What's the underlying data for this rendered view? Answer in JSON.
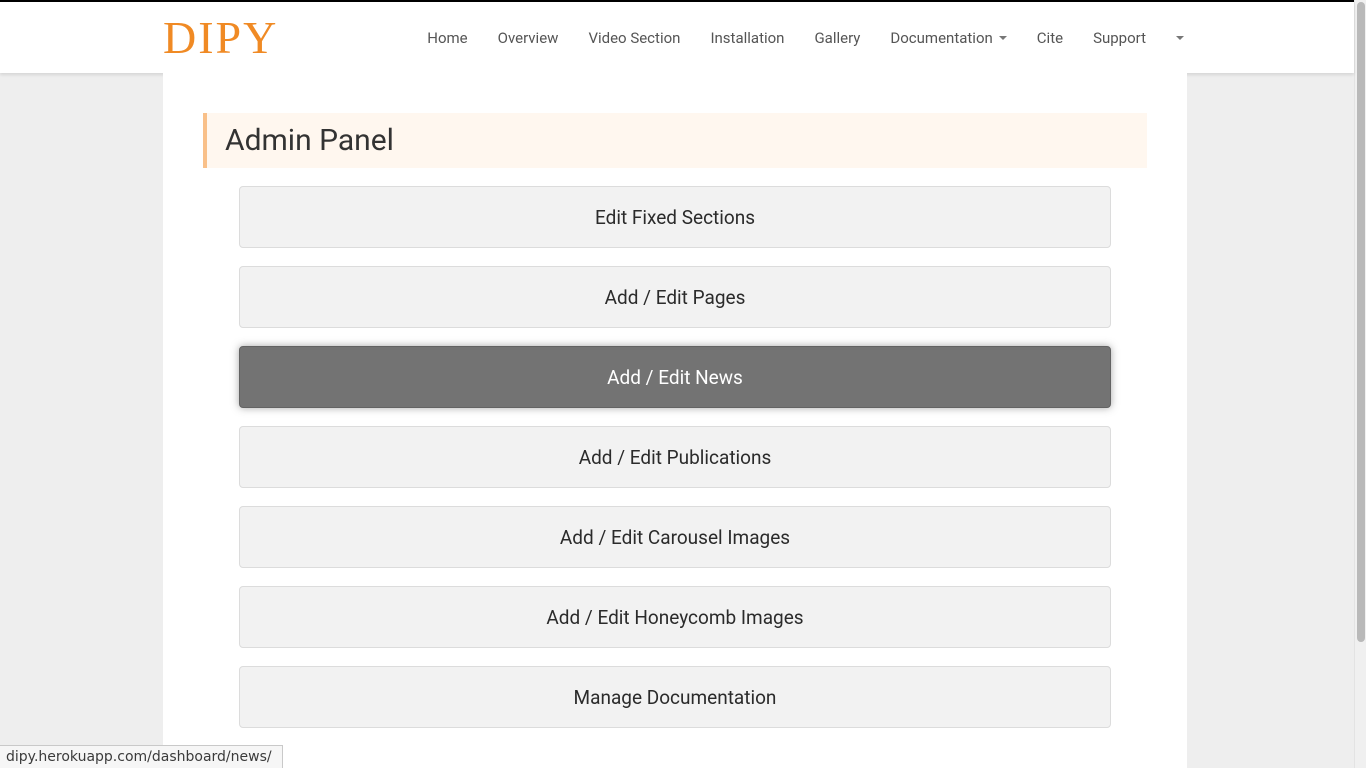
{
  "brand": "DIPY",
  "nav": {
    "home": "Home",
    "overview": "Overview",
    "video": "Video Section",
    "installation": "Installation",
    "gallery": "Gallery",
    "documentation": "Documentation",
    "cite": "Cite",
    "support": "Support"
  },
  "panel": {
    "title": "Admin Panel"
  },
  "buttons": {
    "fixed_sections": "Edit Fixed Sections",
    "pages": "Add / Edit Pages",
    "news": "Add / Edit News",
    "publications": "Add / Edit Publications",
    "carousel": "Add / Edit Carousel Images",
    "honeycomb": "Add / Edit Honeycomb Images",
    "documentation": "Manage Documentation"
  },
  "status_url": "dipy.herokuapp.com/dashboard/news/"
}
